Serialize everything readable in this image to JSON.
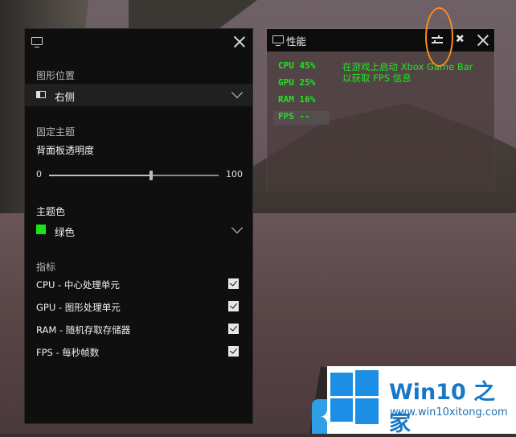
{
  "settings": {
    "graph_position_heading": "图形位置",
    "position_value": "右侧",
    "pin_theme_heading": "固定主题",
    "opacity_label": "背面板透明度",
    "opacity_min": "0",
    "opacity_max": "100",
    "opacity_fraction": 0.6,
    "accent_heading": "主题色",
    "accent_value": "绿色",
    "accent_color": "#19e619",
    "metrics_heading": "指标",
    "metrics": [
      {
        "label": "CPU - 中心处理单元",
        "checked": true
      },
      {
        "label": "GPU - 图形处理单元",
        "checked": true
      },
      {
        "label": "RAM - 随机存取存储器",
        "checked": true
      },
      {
        "label": "FPS - 每秒帧数",
        "checked": true
      }
    ]
  },
  "perf": {
    "title": "性能",
    "cpu": "CPU  45%",
    "gpu": "GPU  25%",
    "ram": "RAM  16%",
    "fps": "FPS --",
    "message_line1": "在游戏上启动 Xbox Game Bar",
    "message_line2": "以获取 FPS 信息"
  },
  "watermark": {
    "brand": "Win10 之家",
    "domain": "www.win10xitong.com",
    "color": "#1c8ee6"
  }
}
